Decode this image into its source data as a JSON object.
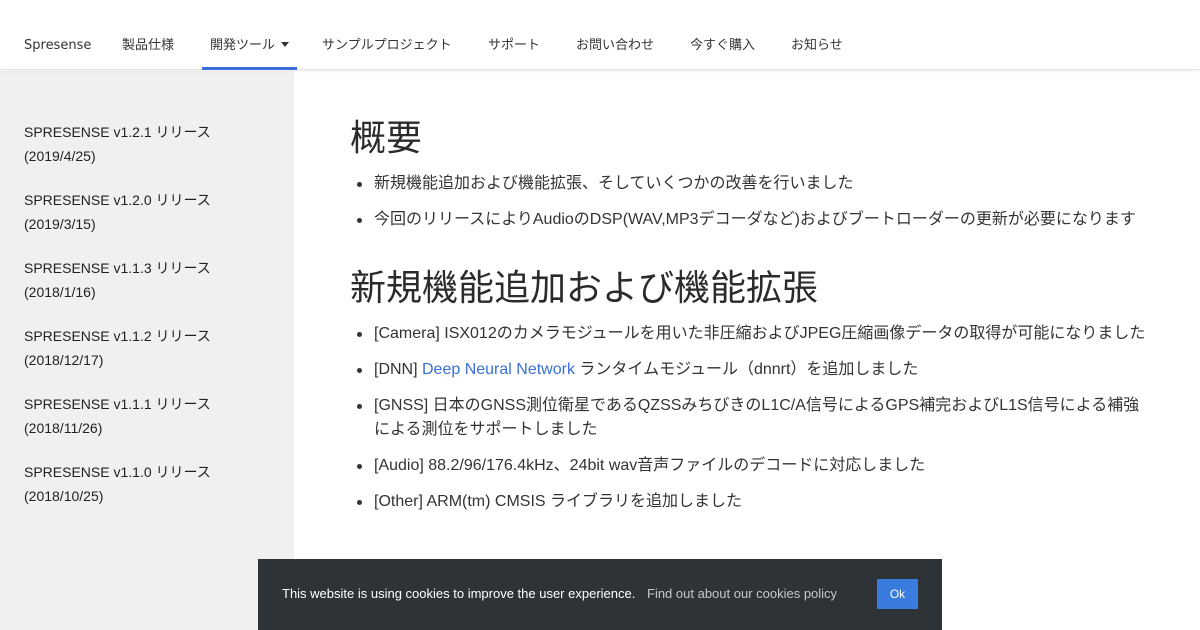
{
  "nav": {
    "items": [
      {
        "label": "Spresense"
      },
      {
        "label": "製品仕様"
      },
      {
        "label": "開発ツール",
        "has_dropdown": true,
        "active": true
      },
      {
        "label": "サンプルプロジェクト"
      },
      {
        "label": "サポート"
      },
      {
        "label": "お問い合わせ"
      },
      {
        "label": "今すぐ購入"
      },
      {
        "label": "お知らせ"
      }
    ],
    "accent_color": "#3a6fd8"
  },
  "sidebar": {
    "items": [
      {
        "title": "SPRESENSE v1.2.1 リリース",
        "date": "(2019/4/25)"
      },
      {
        "title": "SPRESENSE v1.2.0 リリース",
        "date": "(2019/3/15)"
      },
      {
        "title": "SPRESENSE v1.1.3 リリース",
        "date": "(2018/1/16)"
      },
      {
        "title": "SPRESENSE v1.1.2 リリース",
        "date": "(2018/12/17)"
      },
      {
        "title": "SPRESENSE v1.1.1 リリース",
        "date": "(2018/11/26)"
      },
      {
        "title": "SPRESENSE v1.1.0 リリース",
        "date": "(2018/10/25)"
      }
    ]
  },
  "main": {
    "overview": {
      "heading": "概要",
      "bullets": [
        "新規機能追加および機能拡張、そしていくつかの改善を行いました",
        "今回のリリースによりAudioのDSP(WAV,MP3デコーダなど)およびブートローダーの更新が必要になります"
      ]
    },
    "features": {
      "heading": "新規機能追加および機能拡張",
      "bullets": [
        {
          "text": "[Camera] ISX012のカメラモジュールを用いた非圧縮およびJPEG圧縮画像データの取得が可能になりました"
        },
        {
          "prefix": "[DNN] ",
          "link": "Deep Neural Network",
          "suffix": " ランタイムモジュール（dnnrt）を追加しました"
        },
        {
          "text": "[GNSS] 日本のGNSS測位衛星であるQZSSみちびきのL1C/A信号によるGPS補完およびL1S信号による補強による測位をサポートしました"
        },
        {
          "text": "[Audio] 88.2/96/176.4kHz、24bit wav音声ファイルのデコードに対応しました"
        },
        {
          "text": "[Other] ARM(tm) CMSIS ライブラリを追加しました"
        }
      ]
    }
  },
  "cookie": {
    "message": "This website is using cookies to improve the user experience.",
    "policy_link": "Find out about our cookies policy",
    "ok_label": "Ok"
  }
}
